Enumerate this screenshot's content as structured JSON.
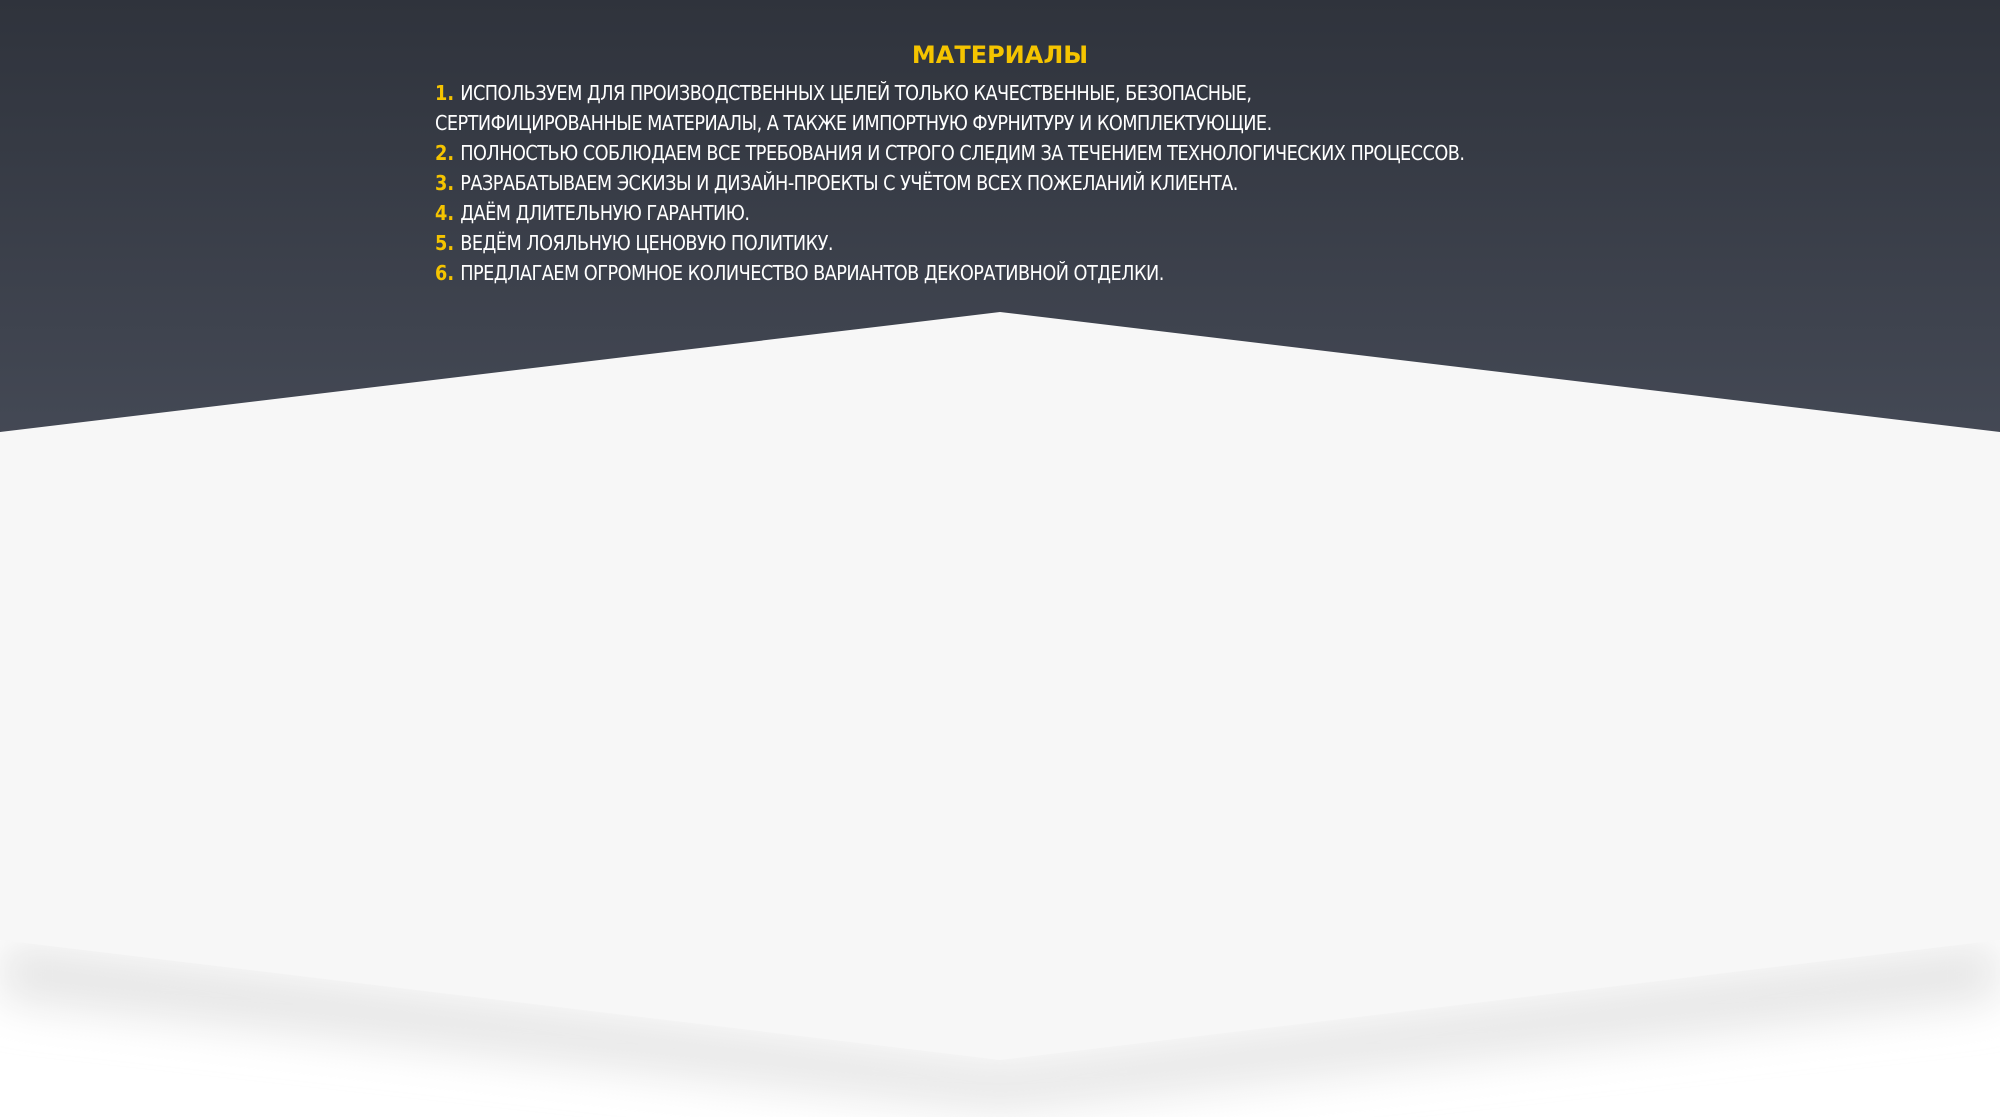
{
  "section": {
    "title": "МАТЕРИАЛЫ",
    "items": [
      {
        "number": "1.",
        "text": "ИСПОЛЬЗУЕМ ДЛЯ ПРОИЗВОДСТВЕННЫХ ЦЕЛЕЙ ТОЛЬКО КАЧЕСТВЕННЫЕ, БЕЗОПАСНЫЕ,",
        "text_line2": "СЕРТИФИЦИРОВАННЫЕ МАТЕРИАЛЫ, А ТАКЖЕ ИМПОРТНУЮ ФУРНИТУРУ И КОМПЛЕКТУЮЩИЕ."
      },
      {
        "number": "2.",
        "text": "ПОЛНОСТЬЮ СОБЛЮДАЕМ ВСЕ ТРЕБОВАНИЯ И СТРОГО СЛЕДИМ ЗА ТЕЧЕНИЕМ ТЕХНОЛОГИЧЕСКИХ ПРОЦЕССОВ."
      },
      {
        "number": "3.",
        "text": "РАЗРАБАТЫВАЕМ ЭСКИЗЫ И ДИЗАЙН-ПРОЕКТЫ С УЧЁТОМ ВСЕХ ПОЖЕЛАНИЙ КЛИЕНТА."
      },
      {
        "number": "4.",
        "text": "ДАЁМ ДЛИТЕЛЬНУЮ ГАРАНТИЮ."
      },
      {
        "number": "5.",
        "text": "ВЕДЁМ ЛОЯЛЬНУЮ ЦЕНОВУЮ ПОЛИТИКУ."
      },
      {
        "number": "6.",
        "text": "ПРЕДЛАГАЕМ ОГРОМНОЕ КОЛИЧЕСТВО ВАРИАНТОВ ДЕКОРАТИВНОЙ ОТДЕЛКИ."
      }
    ]
  },
  "colors": {
    "header_bg_top": "#2f333c",
    "header_bg_bottom": "#434854",
    "panel_bg": "#f7f7f7",
    "page_bg": "#ffffff",
    "accent": "#f5c400",
    "text": "#ffffff"
  }
}
